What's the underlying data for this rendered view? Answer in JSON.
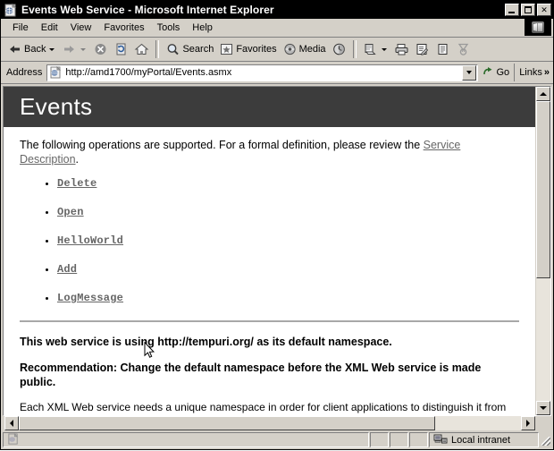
{
  "window": {
    "title": "Events Web Service - Microsoft Internet Explorer",
    "icon": "ie-page-icon",
    "buttons": {
      "minimize": "minimize-button",
      "maximize": "maximize-button",
      "close_label": "✕"
    }
  },
  "menubar": {
    "items": [
      {
        "label": "File"
      },
      {
        "label": "Edit"
      },
      {
        "label": "View"
      },
      {
        "label": "Favorites"
      },
      {
        "label": "Tools"
      },
      {
        "label": "Help"
      }
    ],
    "brand": "internet-explorer-logo"
  },
  "toolbar": {
    "back_label": "Back",
    "forward_label": "",
    "stop_label": "",
    "refresh_label": "",
    "home_label": "",
    "search_label": "Search",
    "favorites_label": "Favorites",
    "media_label": "Media",
    "history_label": "",
    "mail_label": "",
    "print_label": "",
    "edit_label": "",
    "discuss_label": "",
    "messenger_label": ""
  },
  "address": {
    "label": "Address",
    "url": "http://amd1700/myPortal/Events.asmx",
    "placeholder": "",
    "go_label": "Go",
    "links_label": "Links",
    "chevron": "»"
  },
  "page": {
    "heading": "Events",
    "intro_prefix": "The following operations are supported. For a formal definition, please review the ",
    "intro_link": "Service Description",
    "intro_suffix": ".",
    "operations": [
      {
        "name": "Delete"
      },
      {
        "name": "Open"
      },
      {
        "name": "HelloWorld"
      },
      {
        "name": "Add"
      },
      {
        "name": "LogMessage"
      }
    ],
    "namespace_notice": "This web service is using http://tempuri.org/ as its default namespace.",
    "recommendation": "Recommendation: Change the default namespace before the XML Web service is made public.",
    "explanation": "Each XML Web service needs a unique namespace in order for client applications to distinguish it from other services on the Web. http://tempuri.org/ is available for XML Web services that are under development, but published XML Web services should use a more permanent namespace."
  },
  "statusbar": {
    "message": "",
    "zone": "Local intranet",
    "zone_icon": "local-intranet-icon"
  },
  "colors": {
    "banner": "#3c3c3c",
    "chrome": "#d4d0c8",
    "titlebar": "#000000",
    "link": "#666666"
  }
}
